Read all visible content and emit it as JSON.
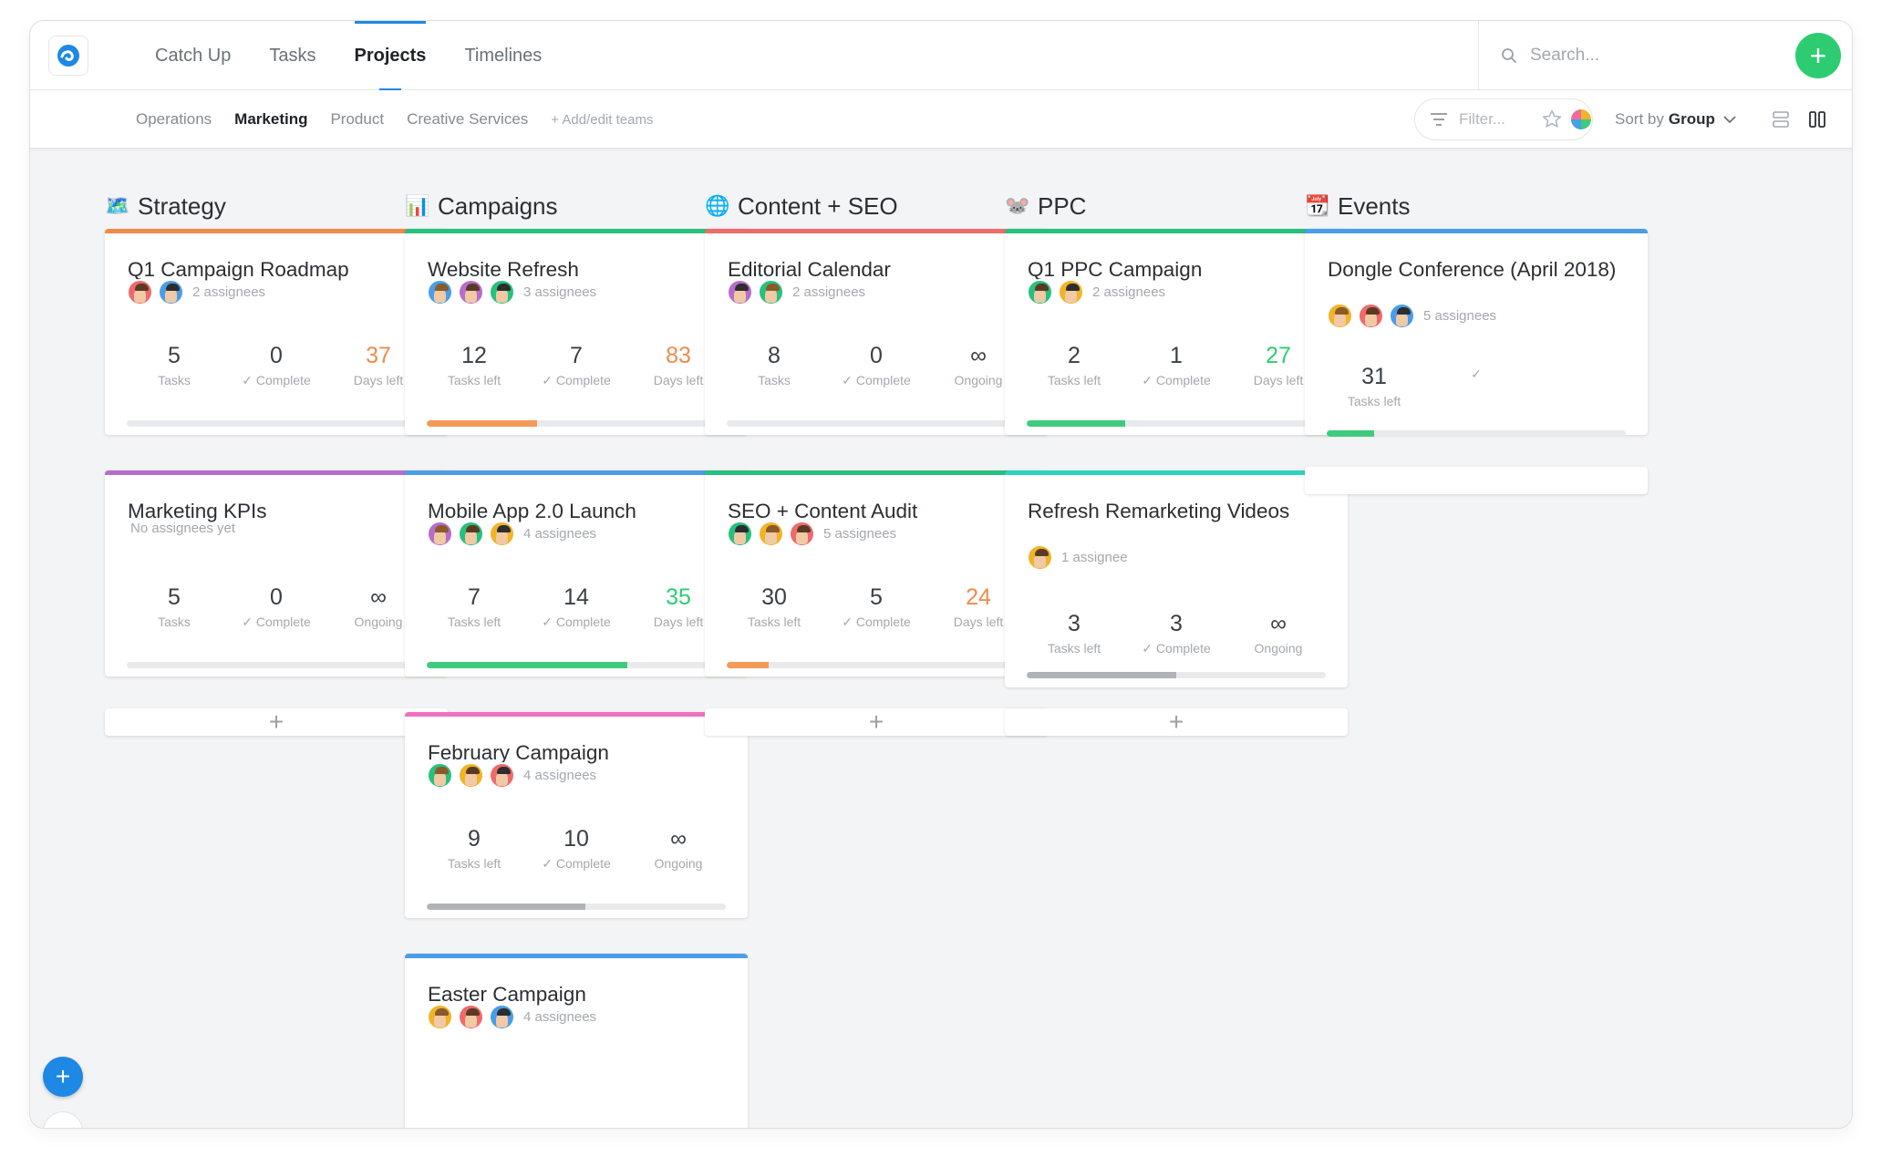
{
  "nav": {
    "tabs": [
      {
        "label": "Catch Up",
        "active": false
      },
      {
        "label": "Tasks",
        "active": false
      },
      {
        "label": "Projects",
        "active": true
      },
      {
        "label": "Timelines",
        "active": false
      }
    ],
    "search_placeholder": "Search...",
    "add_label": "+"
  },
  "subnav": {
    "teams": [
      {
        "label": "Operations",
        "active": false
      },
      {
        "label": "Marketing",
        "active": true
      },
      {
        "label": "Product",
        "active": false
      },
      {
        "label": "Creative Services",
        "active": false
      }
    ],
    "add_teams": "+ Add/edit teams",
    "filter_placeholder": "Filter...",
    "sort_prefix": "Sort by",
    "sort_value": "Group"
  },
  "colors": {
    "accent": "#1e88e5",
    "add_green": "#2ecc71",
    "days_orange": "#f08a4b",
    "days_green": "#2ecc71"
  },
  "columns": [
    {
      "title": "Strategy",
      "icon": "🗺️",
      "cards": [
        {
          "title": "Q1 Campaign Roadmap",
          "color": "#f08a4b",
          "assignees": "2 assignees",
          "avatars": 2,
          "stats": [
            {
              "num": "5",
              "label": "Tasks"
            },
            {
              "num": "0",
              "label": "✓ Complete"
            },
            {
              "num": "37",
              "label": "Days left",
              "tone": "orange"
            }
          ],
          "progress": 0,
          "progress_color": "#f08a4b"
        },
        {
          "title": "Marketing KPIs",
          "color": "#b66dcc",
          "assignees": "No assignees yet",
          "avatars": 0,
          "stats": [
            {
              "num": "5",
              "label": "Tasks"
            },
            {
              "num": "0",
              "label": "✓ Complete"
            },
            {
              "num": "∞",
              "label": "Ongoing"
            }
          ],
          "progress": 0,
          "progress_color": "#b0b4b8"
        }
      ],
      "add": true
    },
    {
      "title": "Campaigns",
      "icon": "📊",
      "cards": [
        {
          "title": "Website Refresh",
          "color": "#27c07d",
          "assignees": "3 assignees",
          "avatars": 3,
          "stats": [
            {
              "num": "12",
              "label": "Tasks left"
            },
            {
              "num": "7",
              "label": "✓ Complete"
            },
            {
              "num": "83",
              "label": "Days left",
              "tone": "orange"
            }
          ],
          "progress": 37,
          "progress_color": "#f49a58"
        },
        {
          "title": "Mobile App 2.0 Launch",
          "color": "#4a9de8",
          "assignees": "4 assignees",
          "avatars": 3,
          "stats": [
            {
              "num": "7",
              "label": "Tasks left"
            },
            {
              "num": "14",
              "label": "✓ Complete"
            },
            {
              "num": "35",
              "label": "Days left",
              "tone": "green"
            }
          ],
          "progress": 67,
          "progress_color": "#3ecb7d"
        },
        {
          "title": "February Campaign",
          "color": "#ee72bf",
          "assignees": "4 assignees",
          "avatars": 3,
          "stats": [
            {
              "num": "9",
              "label": "Tasks left"
            },
            {
              "num": "10",
              "label": "✓ Complete"
            },
            {
              "num": "∞",
              "label": "Ongoing"
            }
          ],
          "progress": 53,
          "progress_color": "#b0b4b8"
        },
        {
          "title": "Easter Campaign",
          "color": "#4a9de8",
          "assignees": "4 assignees",
          "avatars": 3,
          "stats": [],
          "progress": null,
          "progress_color": "#b0b4b8"
        }
      ],
      "add": false
    },
    {
      "title": "Content + SEO",
      "icon": "🌐",
      "cards": [
        {
          "title": "Editorial Calendar",
          "color": "#ee6b6b",
          "assignees": "2 assignees",
          "avatars": 2,
          "stats": [
            {
              "num": "8",
              "label": "Tasks"
            },
            {
              "num": "0",
              "label": "✓ Complete"
            },
            {
              "num": "∞",
              "label": "Ongoing"
            }
          ],
          "progress": 0,
          "progress_color": "#b0b4b8"
        },
        {
          "title": "SEO + Content Audit",
          "color": "#27c07d",
          "assignees": "5 assignees",
          "avatars": 3,
          "stats": [
            {
              "num": "30",
              "label": "Tasks left"
            },
            {
              "num": "5",
              "label": "✓ Complete"
            },
            {
              "num": "24",
              "label": "Days left",
              "tone": "orange"
            }
          ],
          "progress": 14,
          "progress_color": "#f49a58"
        }
      ],
      "add": true
    },
    {
      "title": "PPC",
      "icon": "🐭",
      "cards": [
        {
          "title": "Q1 PPC Campaign",
          "color": "#27c07d",
          "assignees": "2 assignees",
          "avatars": 2,
          "stats": [
            {
              "num": "2",
              "label": "Tasks left"
            },
            {
              "num": "1",
              "label": "✓ Complete"
            },
            {
              "num": "27",
              "label": "Days left",
              "tone": "green"
            }
          ],
          "progress": 33,
          "progress_color": "#3ecb7d"
        },
        {
          "title": "Refresh Remarketing Videos",
          "color": "#2ed1c0",
          "assignees": "1 assignee",
          "avatars": 1,
          "stats": [
            {
              "num": "3",
              "label": "Tasks left"
            },
            {
              "num": "3",
              "label": "✓ Complete"
            },
            {
              "num": "∞",
              "label": "Ongoing"
            }
          ],
          "progress": 50,
          "progress_color": "#b0b4b8"
        }
      ],
      "add": true
    },
    {
      "title": "Events",
      "icon": "📆",
      "cards": [
        {
          "title": "Dongle Conference (April 2018)",
          "color": "#4a9de8",
          "assignees": "5 assignees",
          "avatars": 3,
          "stats": [
            {
              "num": "31",
              "label": "Tasks left"
            },
            {
              "num": "",
              "label": "✓"
            },
            {
              "num": "",
              "label": ""
            }
          ],
          "progress": 16,
          "progress_color": "#3ecb7d"
        }
      ],
      "add": false
    }
  ]
}
